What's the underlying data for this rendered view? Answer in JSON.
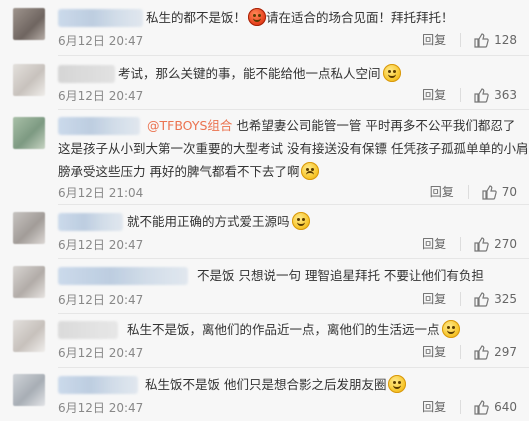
{
  "comments": [
    {
      "parts": [
        "私生的都不是饭！",
        "请在适合的场合见面！拜托拜托！"
      ],
      "emoji": "angry-face-icon",
      "date": "6月12日 20:47",
      "reply_label": "回复",
      "likes": "128"
    },
    {
      "parts": [
        "考试，那么关键的事，能不能给他一点私人空间"
      ],
      "emoji": "wink-face-icon",
      "date": "6月12日 20:47",
      "reply_label": "回复",
      "likes": "363"
    },
    {
      "mention": "@TFBOYS组合",
      "lines": [
        "也希望妻公司能管一管 平时再多不公平我们都忍了",
        "这是孩子从小到大第一次重要的大型考试 没有接送没有保镖 任凭孩子孤孤单单的小肩",
        "膀承受这些压力 再好的脾气都看不下去了啊"
      ],
      "emoji": "crying-face-icon",
      "date": "6月12日 21:04",
      "reply_label": "回复",
      "likes": "70"
    },
    {
      "parts": [
        "就不能用正确的方式爱王源吗"
      ],
      "emoji": "laughing-face-icon",
      "date": "6月12日 20:47",
      "reply_label": "回复",
      "likes": "270"
    },
    {
      "parts": [
        "不是饭 只想说一句 理智追星拜托 不要让他们有负担"
      ],
      "date": "6月12日 20:47",
      "reply_label": "回复",
      "likes": "325"
    },
    {
      "parts": [
        "私生不是饭，离他们的作品近一点，离他们的生活远一点"
      ],
      "emoji": "smile-face-icon",
      "date": "6月12日 20:47",
      "reply_label": "回复",
      "likes": "297"
    },
    {
      "parts": [
        "私生饭不是饭   他们只是想合影之后发朋友圈"
      ],
      "emoji": "smile-face-icon",
      "date": "6月12日 20:47",
      "reply_label": "回复",
      "likes": "640"
    }
  ]
}
